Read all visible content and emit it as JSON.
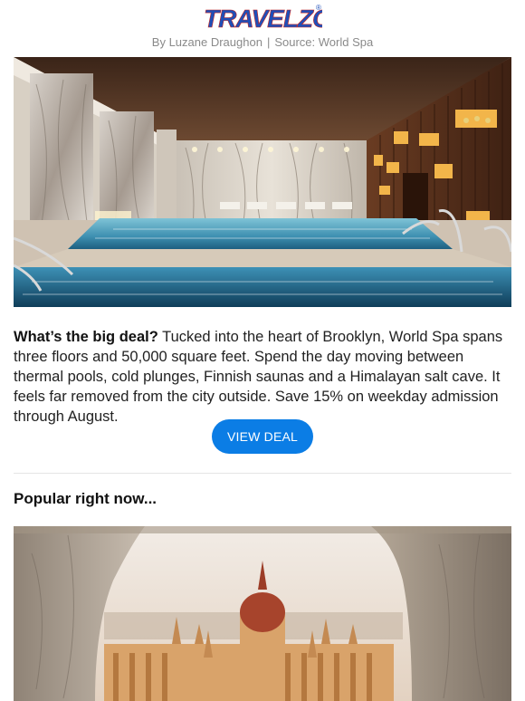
{
  "brand": {
    "logo_text": "TRAVELZOO",
    "logo_mark": "®"
  },
  "byline": {
    "author": "By Luzane Draughon",
    "separator": "|",
    "source": "Source: World Spa"
  },
  "deal": {
    "heading": "What’s the big deal?",
    "body": " Tucked into the heart of Brooklyn, World Spa spans three floors and 50,000 square feet. Spend the day moving between thermal pools, cold plunges, Finnish saunas and a Himalayan salt cave. It feels far removed from the city outside. Save 15% on weekday admission through August.",
    "cta_label": "VIEW DEAL"
  },
  "popular": {
    "title": "Popular right now..."
  },
  "colors": {
    "brand_blue": "#1f4fb8",
    "brand_red": "#e0262b",
    "cta": "#0b7de5",
    "muted": "#8a8a8a"
  }
}
